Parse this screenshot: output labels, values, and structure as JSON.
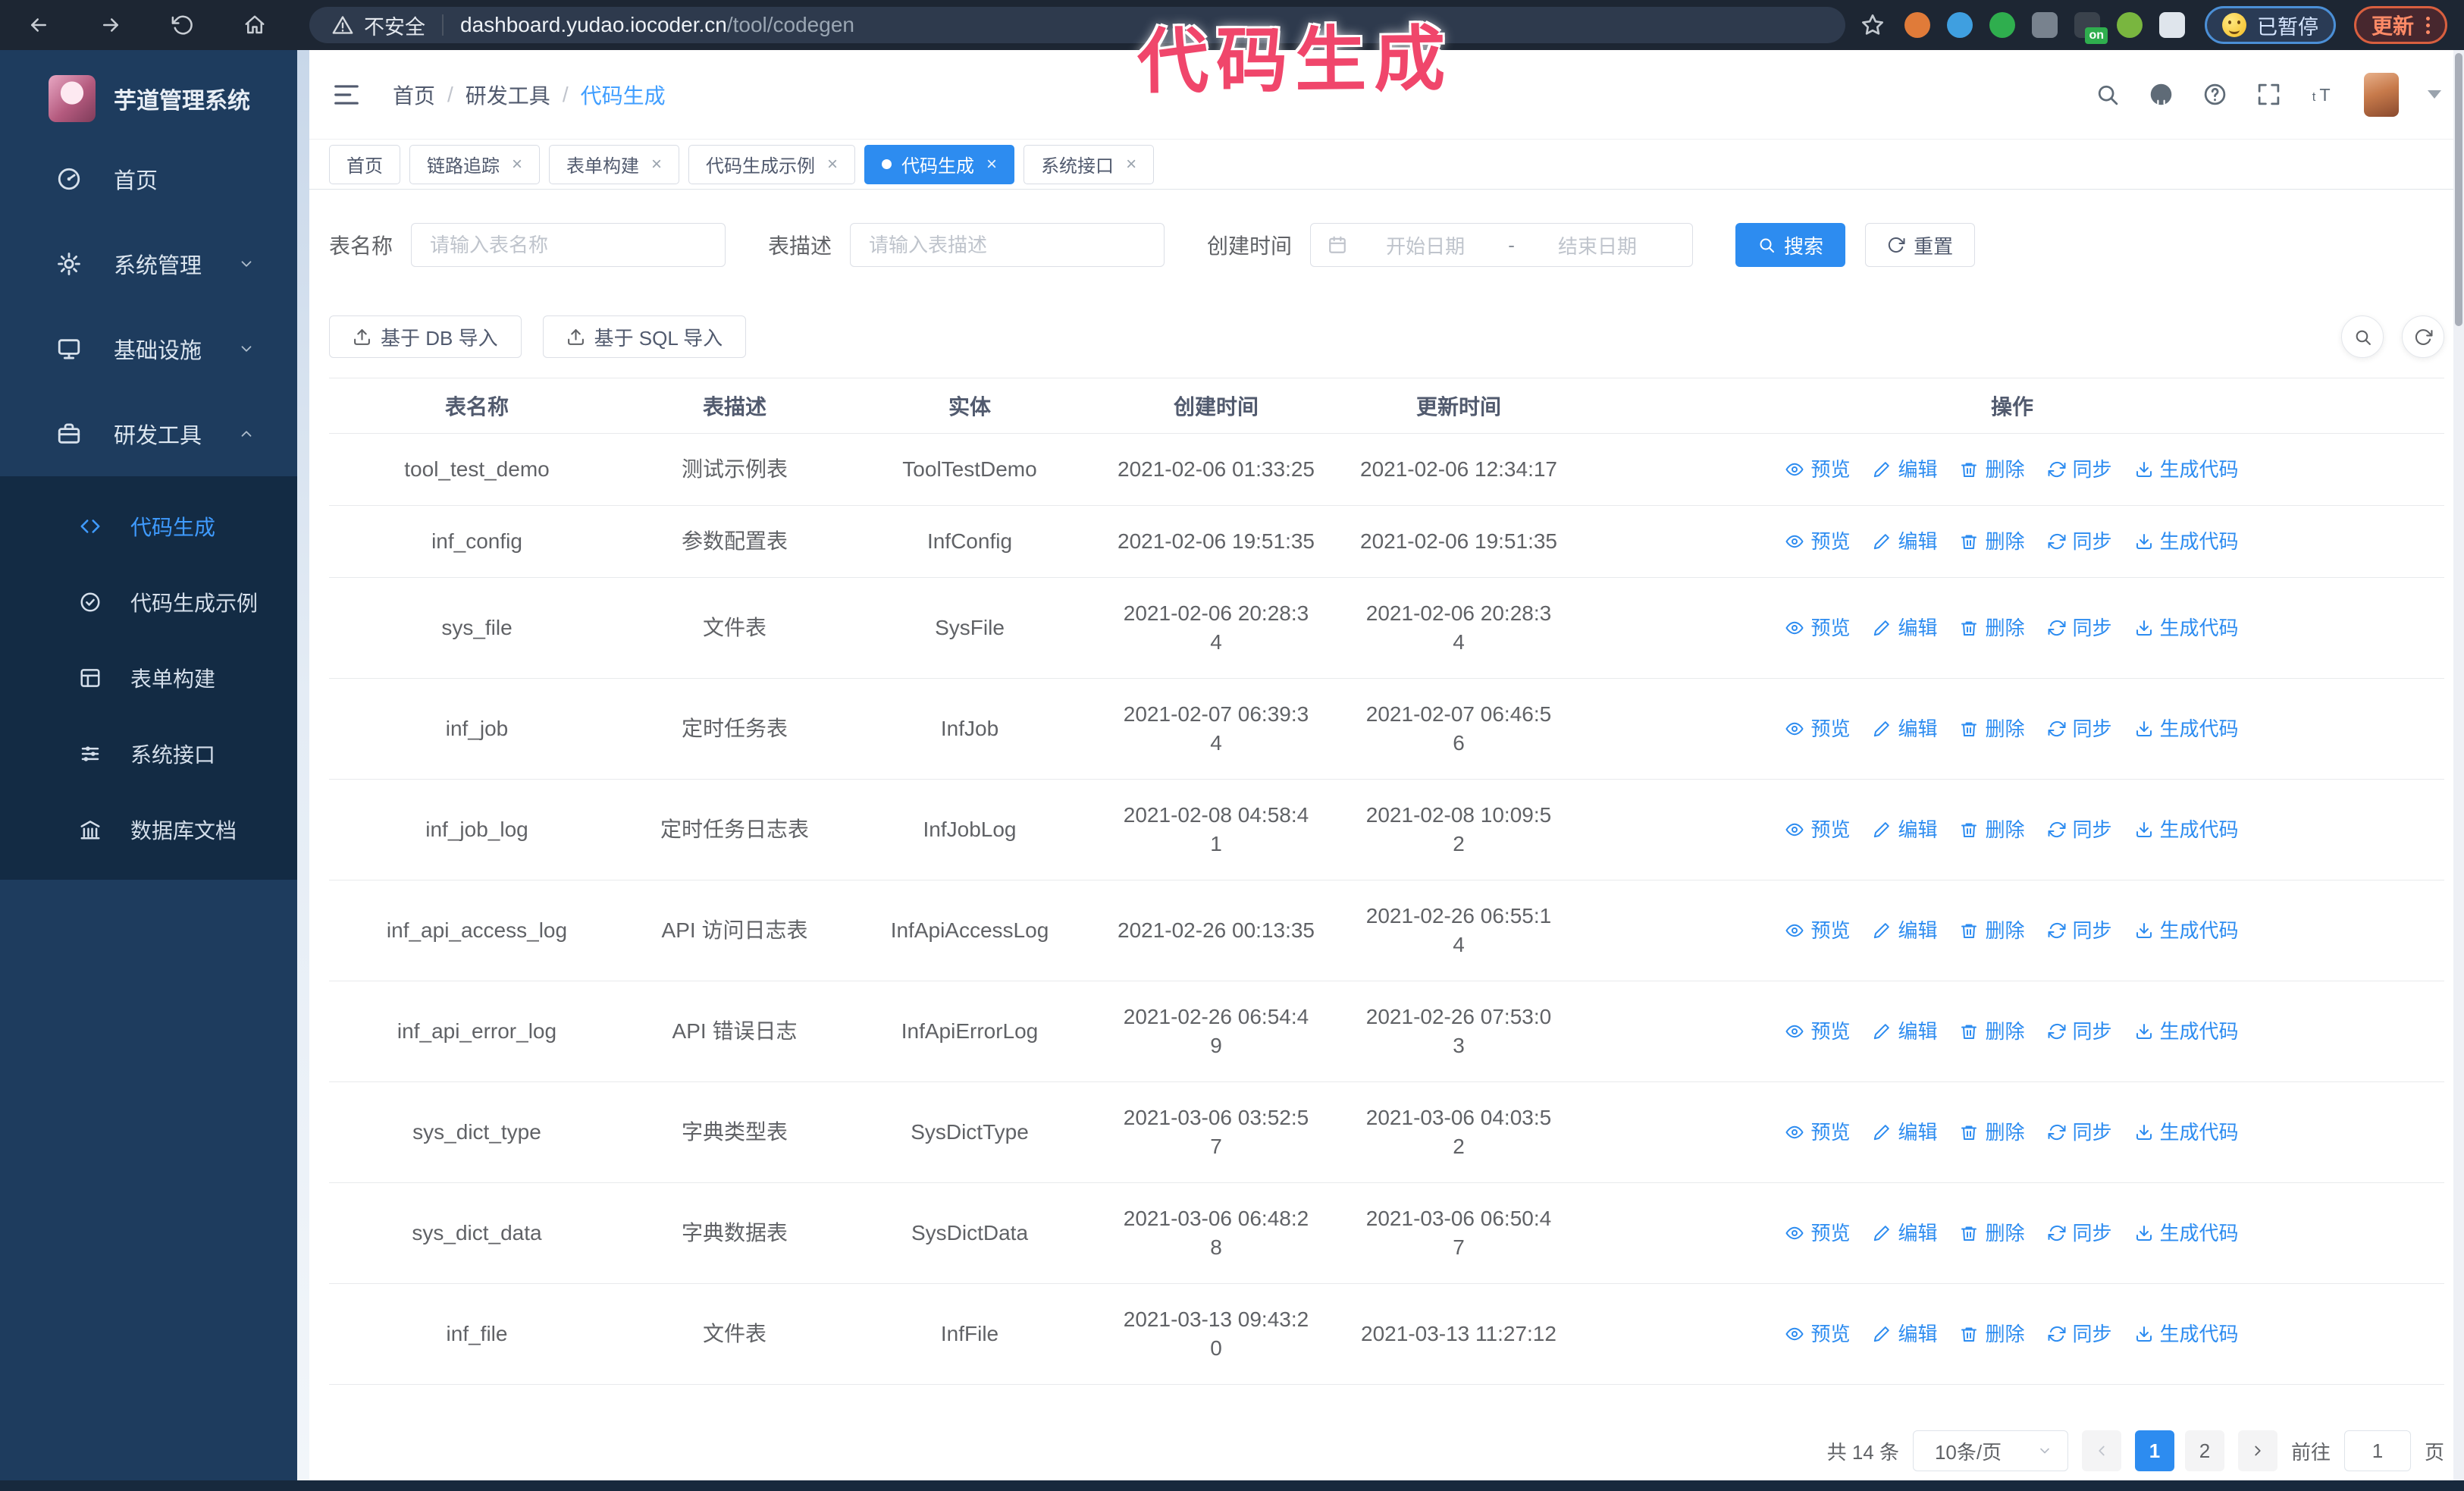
{
  "browser": {
    "security_warning": "不安全",
    "url_domain": "dashboard.yudao.iocoder.cn",
    "url_path": "/tool/codegen",
    "paused_badge": "已暂停",
    "update_button": "更新",
    "extensions": [
      {
        "name": "extension-icon-orange",
        "color": "#e07b39",
        "shape": "circle"
      },
      {
        "name": "extension-icon-blue-drop",
        "color": "#3f9fe0",
        "shape": "circle"
      },
      {
        "name": "extension-icon-green-check",
        "color": "#2fae4e",
        "shape": "circle"
      },
      {
        "name": "extension-icon-grid",
        "color": "#78828e",
        "shape": "square"
      },
      {
        "name": "extension-icon-dark",
        "color": "#3a424c",
        "shape": "square",
        "badge": "on"
      },
      {
        "name": "extension-icon-green-bot",
        "color": "#79b63f",
        "shape": "circle"
      },
      {
        "name": "extension-icon-puzzle",
        "color": "#dfe5ec",
        "shape": "square"
      }
    ]
  },
  "annotation": "代码生成",
  "app": {
    "title": "芋道管理系统"
  },
  "sidebar": {
    "items": [
      {
        "label": "首页",
        "icon": "gauge-icon",
        "chevron": null
      },
      {
        "label": "系统管理",
        "icon": "gear-icon",
        "chevron": "down"
      },
      {
        "label": "基础设施",
        "icon": "monitor-icon",
        "chevron": "down"
      },
      {
        "label": "研发工具",
        "icon": "toolbox-icon",
        "chevron": "up"
      }
    ],
    "submenu": [
      {
        "label": "代码生成",
        "icon": "code-icon",
        "active": true
      },
      {
        "label": "代码生成示例",
        "icon": "badge-check-icon",
        "active": false
      },
      {
        "label": "表单构建",
        "icon": "form-icon",
        "active": false
      },
      {
        "label": "系统接口",
        "icon": "sliders-icon",
        "active": false
      },
      {
        "label": "数据库文档",
        "icon": "db-icon",
        "active": false
      }
    ]
  },
  "breadcrumb": [
    "首页",
    "研发工具",
    "代码生成"
  ],
  "tabs": [
    {
      "label": "首页",
      "closable": false,
      "active": false
    },
    {
      "label": "链路追踪",
      "closable": true,
      "active": false
    },
    {
      "label": "表单构建",
      "closable": true,
      "active": false
    },
    {
      "label": "代码生成示例",
      "closable": true,
      "active": false
    },
    {
      "label": "代码生成",
      "closable": true,
      "active": true
    },
    {
      "label": "系统接口",
      "closable": true,
      "active": false
    }
  ],
  "filters": {
    "table_name_label": "表名称",
    "table_name_placeholder": "请输入表名称",
    "table_desc_label": "表描述",
    "table_desc_placeholder": "请输入表描述",
    "create_time_label": "创建时间",
    "start_date_placeholder": "开始日期",
    "range_separator": "-",
    "end_date_placeholder": "结束日期",
    "search_label": "搜索",
    "reset_label": "重置"
  },
  "toolbar": {
    "import_db_label": "基于 DB 导入",
    "import_sql_label": "基于 SQL 导入"
  },
  "table": {
    "columns": [
      "表名称",
      "表描述",
      "实体",
      "创建时间",
      "更新时间",
      "操作"
    ],
    "actions": [
      {
        "label": "预览",
        "icon": "eye-icon"
      },
      {
        "label": "编辑",
        "icon": "edit-icon"
      },
      {
        "label": "删除",
        "icon": "trash-icon"
      },
      {
        "label": "同步",
        "icon": "sync-icon"
      },
      {
        "label": "生成代码",
        "icon": "download-icon"
      }
    ],
    "rows": [
      {
        "name": "tool_test_demo",
        "desc": "测试示例表",
        "entity": "ToolTestDemo",
        "created": "2021-02-06 01:33:25",
        "updated": "2021-02-06 12:34:17"
      },
      {
        "name": "inf_config",
        "desc": "参数配置表",
        "entity": "InfConfig",
        "created": "2021-02-06 19:51:35",
        "updated": "2021-02-06 19:51:35"
      },
      {
        "name": "sys_file",
        "desc": "文件表",
        "entity": "SysFile",
        "created": "2021-02-06 20:28:3\n4",
        "updated": "2021-02-06 20:28:3\n4"
      },
      {
        "name": "inf_job",
        "desc": "定时任务表",
        "entity": "InfJob",
        "created": "2021-02-07 06:39:3\n4",
        "updated": "2021-02-07 06:46:5\n6"
      },
      {
        "name": "inf_job_log",
        "desc": "定时任务日志表",
        "entity": "InfJobLog",
        "created": "2021-02-08 04:58:4\n1",
        "updated": "2021-02-08 10:09:5\n2"
      },
      {
        "name": "inf_api_access_log",
        "desc": "API 访问日志表",
        "entity": "InfApiAccessLog",
        "created": "2021-02-26 00:13:35",
        "updated": "2021-02-26 06:55:1\n4"
      },
      {
        "name": "inf_api_error_log",
        "desc": "API 错误日志",
        "entity": "InfApiErrorLog",
        "created": "2021-02-26 06:54:4\n9",
        "updated": "2021-02-26 07:53:0\n3"
      },
      {
        "name": "sys_dict_type",
        "desc": "字典类型表",
        "entity": "SysDictType",
        "created": "2021-03-06 03:52:5\n7",
        "updated": "2021-03-06 04:03:5\n2"
      },
      {
        "name": "sys_dict_data",
        "desc": "字典数据表",
        "entity": "SysDictData",
        "created": "2021-03-06 06:48:2\n8",
        "updated": "2021-03-06 06:50:4\n7"
      },
      {
        "name": "inf_file",
        "desc": "文件表",
        "entity": "InfFile",
        "created": "2021-03-13 09:43:2\n0",
        "updated": "2021-03-13 11:27:12"
      }
    ]
  },
  "pagination": {
    "total_text": "共 14 条",
    "page_size": "10条/页",
    "pages": [
      "1",
      "2"
    ],
    "active_page": "1",
    "goto_label": "前往",
    "goto_value": "1",
    "page_label": "页"
  },
  "colors": {
    "primary": "#2d8cf0",
    "sidebar_bg": "#1e3c5e",
    "submenu_bg": "#132b44",
    "active_menu_text": "#3f9bff",
    "annotation_pink": "#f0466b",
    "chrome_bg": "#1d2633",
    "update_accent": "#d85f3f",
    "paused_accent": "#4b8fd6"
  }
}
